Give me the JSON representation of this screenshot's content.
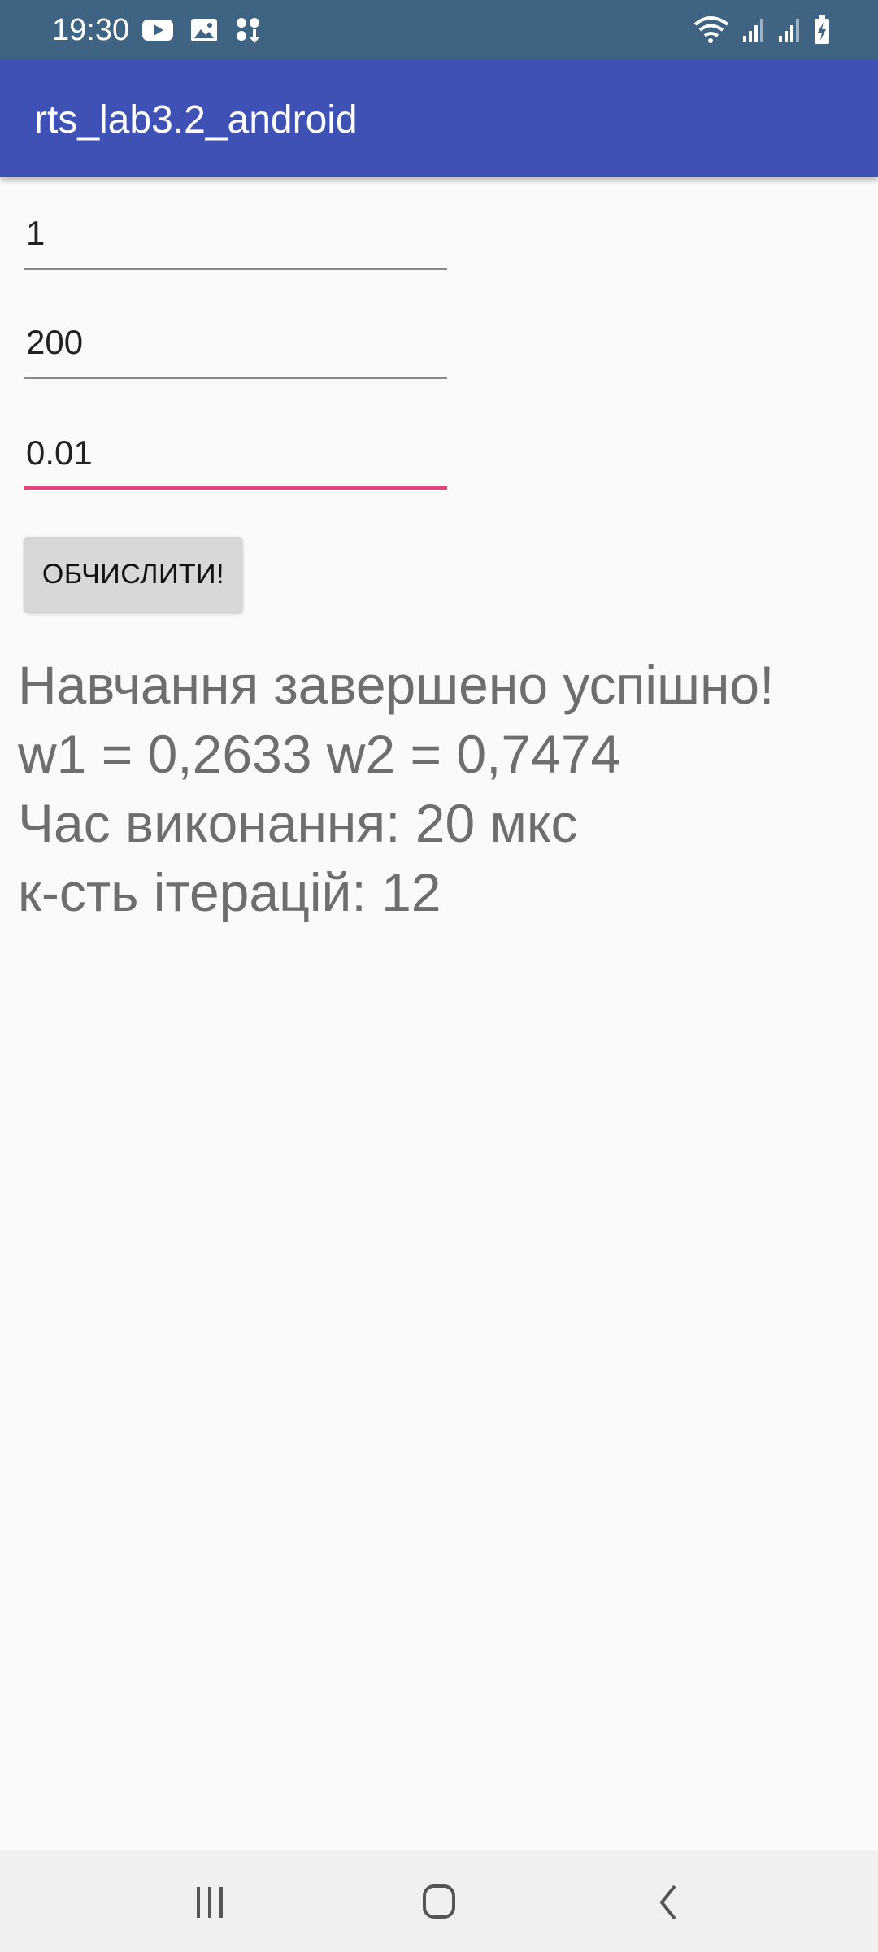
{
  "status_bar": {
    "time": "19:30",
    "left_icons": [
      "youtube-icon",
      "gallery-icon",
      "app-store-icon"
    ],
    "right_icons": [
      "wifi-icon",
      "signal-icon",
      "signal-icon",
      "battery-charging-icon"
    ]
  },
  "app_bar": {
    "title": "rts_lab3.2_android"
  },
  "form": {
    "field1_value": "1",
    "field2_value": "200",
    "field3_value": "0.01",
    "button_label": "ОБЧИСЛИТИ!"
  },
  "result": {
    "line1": "Навчання завершено успішно!",
    "line2": "w1 = 0,2633 w2 = 0,7474",
    "line3": "Час виконання: 20 мкс",
    "line4": "к-сть ітерацій: 12"
  },
  "nav_bar": {
    "icons": [
      "recents-icon",
      "home-icon",
      "back-icon"
    ]
  },
  "colors": {
    "status_bar": "#3f6382",
    "app_bar": "#3f51b5",
    "focus_accent": "#e8437f",
    "result_text": "#6e6e6e"
  }
}
